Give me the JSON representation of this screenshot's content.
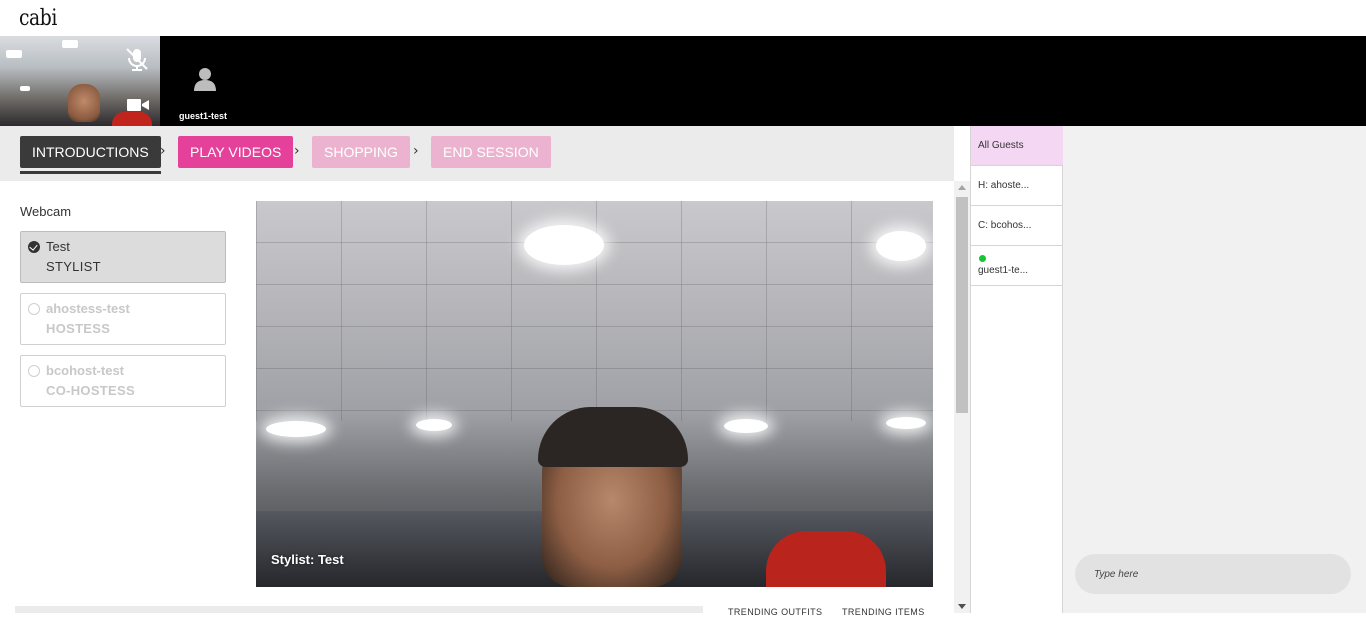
{
  "app": {
    "logo_text": "cabi"
  },
  "video_strip": {
    "guest_name": "guest1-test",
    "icons": {
      "mic": "mic-off-icon",
      "camera": "camera-icon",
      "guest_avatar": "user-icon"
    }
  },
  "steps": [
    {
      "label": "INTRODUCTIONS",
      "state": "current",
      "color": "#3a3a3a"
    },
    {
      "label": "PLAY VIDEOS",
      "state": "active",
      "color": "#e5419b"
    },
    {
      "label": "SHOPPING",
      "state": "disabled",
      "color": "#ecb3d1"
    },
    {
      "label": "END SESSION",
      "state": "disabled",
      "color": "#ecb3d1"
    }
  ],
  "webcam": {
    "title": "Webcam",
    "cameras": [
      {
        "name": "Test",
        "role": "STYLIST",
        "selected": true
      },
      {
        "name": "ahostess-test",
        "role": "HOSTESS",
        "selected": false
      },
      {
        "name": "bcohost-test",
        "role": "CO-HOSTESS",
        "selected": false
      }
    ],
    "video_caption": "Stylist: Test"
  },
  "bottom_tabs": {
    "trending_outfits": "TRENDING OUTFITS",
    "trending_items": "TRENDING ITEMS"
  },
  "guests": {
    "items": [
      {
        "label": "All Guests",
        "selected": true
      },
      {
        "label": "H: ahoste..."
      },
      {
        "label": "C: bcohos..."
      },
      {
        "label": "guest1-te...",
        "online": true,
        "status_color": "#19c436"
      }
    ]
  },
  "chat": {
    "placeholder": "Type here"
  }
}
